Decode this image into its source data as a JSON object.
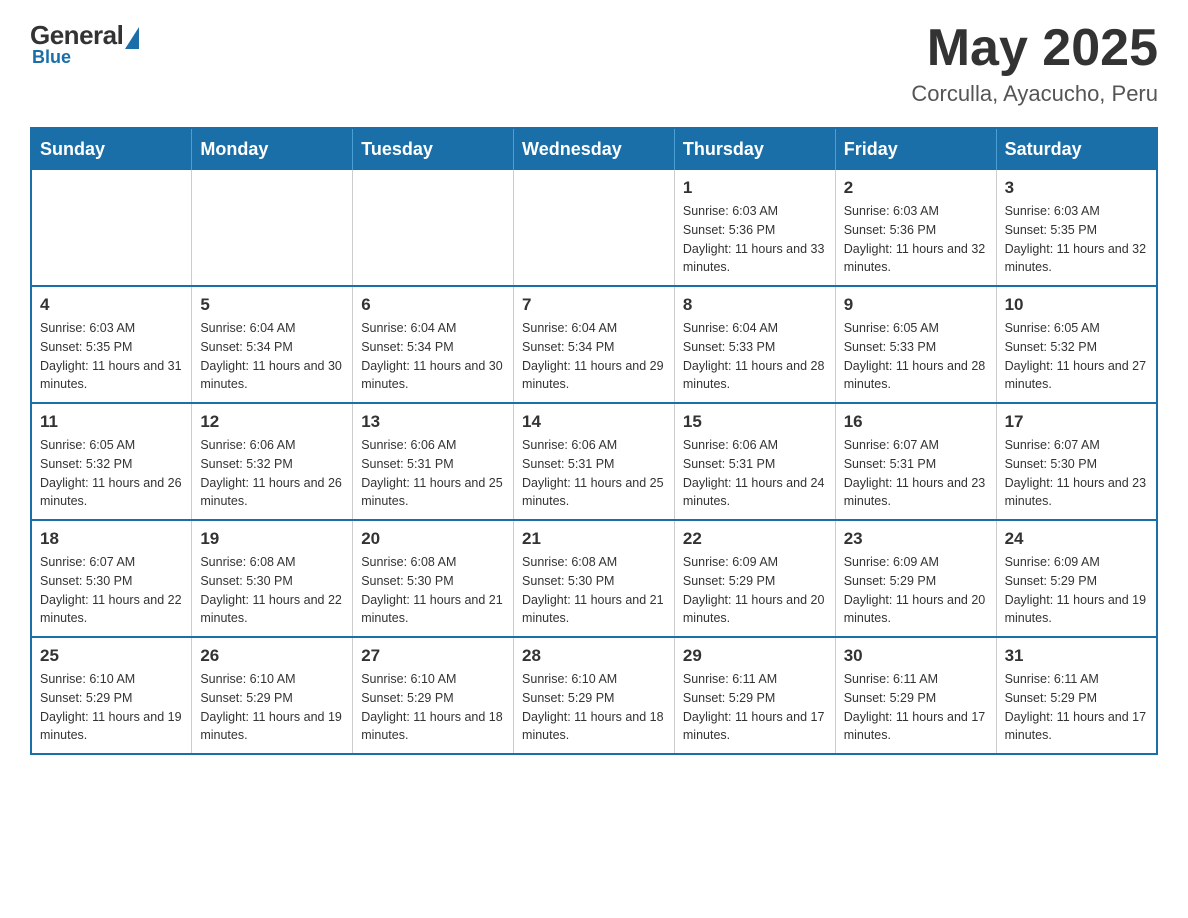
{
  "header": {
    "logo": {
      "general": "General",
      "blue": "Blue"
    },
    "title": "May 2025",
    "location": "Corculla, Ayacucho, Peru"
  },
  "days_of_week": [
    "Sunday",
    "Monday",
    "Tuesday",
    "Wednesday",
    "Thursday",
    "Friday",
    "Saturday"
  ],
  "weeks": [
    [
      {
        "day": "",
        "info": ""
      },
      {
        "day": "",
        "info": ""
      },
      {
        "day": "",
        "info": ""
      },
      {
        "day": "",
        "info": ""
      },
      {
        "day": "1",
        "info": "Sunrise: 6:03 AM\nSunset: 5:36 PM\nDaylight: 11 hours and 33 minutes."
      },
      {
        "day": "2",
        "info": "Sunrise: 6:03 AM\nSunset: 5:36 PM\nDaylight: 11 hours and 32 minutes."
      },
      {
        "day": "3",
        "info": "Sunrise: 6:03 AM\nSunset: 5:35 PM\nDaylight: 11 hours and 32 minutes."
      }
    ],
    [
      {
        "day": "4",
        "info": "Sunrise: 6:03 AM\nSunset: 5:35 PM\nDaylight: 11 hours and 31 minutes."
      },
      {
        "day": "5",
        "info": "Sunrise: 6:04 AM\nSunset: 5:34 PM\nDaylight: 11 hours and 30 minutes."
      },
      {
        "day": "6",
        "info": "Sunrise: 6:04 AM\nSunset: 5:34 PM\nDaylight: 11 hours and 30 minutes."
      },
      {
        "day": "7",
        "info": "Sunrise: 6:04 AM\nSunset: 5:34 PM\nDaylight: 11 hours and 29 minutes."
      },
      {
        "day": "8",
        "info": "Sunrise: 6:04 AM\nSunset: 5:33 PM\nDaylight: 11 hours and 28 minutes."
      },
      {
        "day": "9",
        "info": "Sunrise: 6:05 AM\nSunset: 5:33 PM\nDaylight: 11 hours and 28 minutes."
      },
      {
        "day": "10",
        "info": "Sunrise: 6:05 AM\nSunset: 5:32 PM\nDaylight: 11 hours and 27 minutes."
      }
    ],
    [
      {
        "day": "11",
        "info": "Sunrise: 6:05 AM\nSunset: 5:32 PM\nDaylight: 11 hours and 26 minutes."
      },
      {
        "day": "12",
        "info": "Sunrise: 6:06 AM\nSunset: 5:32 PM\nDaylight: 11 hours and 26 minutes."
      },
      {
        "day": "13",
        "info": "Sunrise: 6:06 AM\nSunset: 5:31 PM\nDaylight: 11 hours and 25 minutes."
      },
      {
        "day": "14",
        "info": "Sunrise: 6:06 AM\nSunset: 5:31 PM\nDaylight: 11 hours and 25 minutes."
      },
      {
        "day": "15",
        "info": "Sunrise: 6:06 AM\nSunset: 5:31 PM\nDaylight: 11 hours and 24 minutes."
      },
      {
        "day": "16",
        "info": "Sunrise: 6:07 AM\nSunset: 5:31 PM\nDaylight: 11 hours and 23 minutes."
      },
      {
        "day": "17",
        "info": "Sunrise: 6:07 AM\nSunset: 5:30 PM\nDaylight: 11 hours and 23 minutes."
      }
    ],
    [
      {
        "day": "18",
        "info": "Sunrise: 6:07 AM\nSunset: 5:30 PM\nDaylight: 11 hours and 22 minutes."
      },
      {
        "day": "19",
        "info": "Sunrise: 6:08 AM\nSunset: 5:30 PM\nDaylight: 11 hours and 22 minutes."
      },
      {
        "day": "20",
        "info": "Sunrise: 6:08 AM\nSunset: 5:30 PM\nDaylight: 11 hours and 21 minutes."
      },
      {
        "day": "21",
        "info": "Sunrise: 6:08 AM\nSunset: 5:30 PM\nDaylight: 11 hours and 21 minutes."
      },
      {
        "day": "22",
        "info": "Sunrise: 6:09 AM\nSunset: 5:29 PM\nDaylight: 11 hours and 20 minutes."
      },
      {
        "day": "23",
        "info": "Sunrise: 6:09 AM\nSunset: 5:29 PM\nDaylight: 11 hours and 20 minutes."
      },
      {
        "day": "24",
        "info": "Sunrise: 6:09 AM\nSunset: 5:29 PM\nDaylight: 11 hours and 19 minutes."
      }
    ],
    [
      {
        "day": "25",
        "info": "Sunrise: 6:10 AM\nSunset: 5:29 PM\nDaylight: 11 hours and 19 minutes."
      },
      {
        "day": "26",
        "info": "Sunrise: 6:10 AM\nSunset: 5:29 PM\nDaylight: 11 hours and 19 minutes."
      },
      {
        "day": "27",
        "info": "Sunrise: 6:10 AM\nSunset: 5:29 PM\nDaylight: 11 hours and 18 minutes."
      },
      {
        "day": "28",
        "info": "Sunrise: 6:10 AM\nSunset: 5:29 PM\nDaylight: 11 hours and 18 minutes."
      },
      {
        "day": "29",
        "info": "Sunrise: 6:11 AM\nSunset: 5:29 PM\nDaylight: 11 hours and 17 minutes."
      },
      {
        "day": "30",
        "info": "Sunrise: 6:11 AM\nSunset: 5:29 PM\nDaylight: 11 hours and 17 minutes."
      },
      {
        "day": "31",
        "info": "Sunrise: 6:11 AM\nSunset: 5:29 PM\nDaylight: 11 hours and 17 minutes."
      }
    ]
  ]
}
